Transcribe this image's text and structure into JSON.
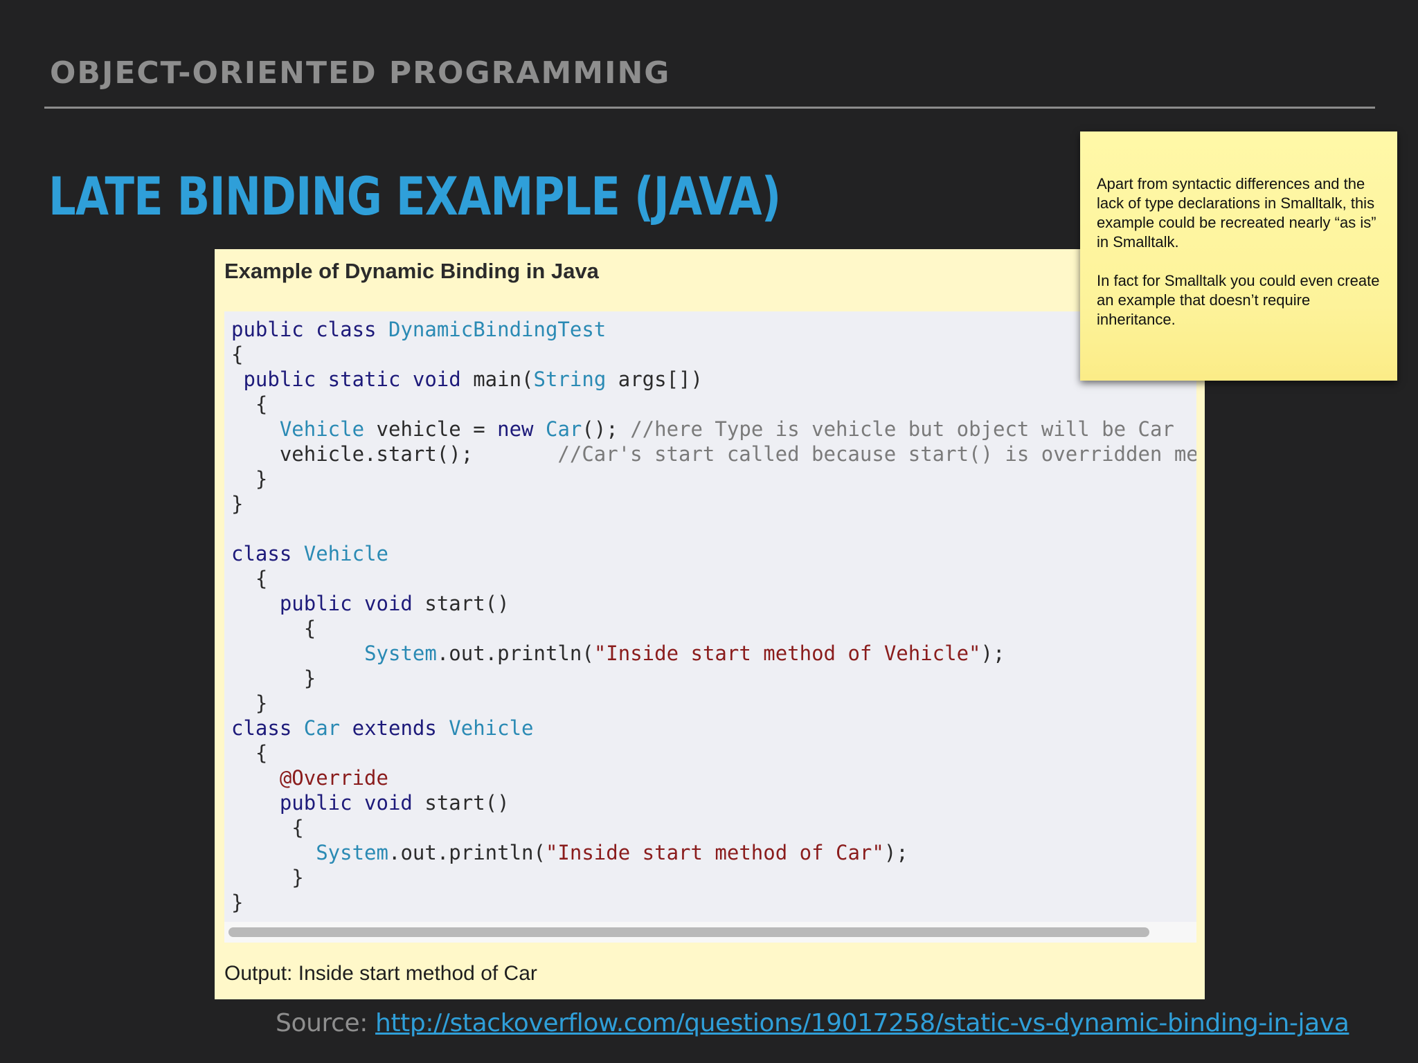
{
  "slide": {
    "section_title": "OBJECT-ORIENTED PROGRAMMING",
    "title": "LATE BINDING EXAMPLE (JAVA)"
  },
  "example": {
    "heading": "Example of Dynamic Binding in Java",
    "output": "Output: Inside start method of Car",
    "code_lines": [
      [
        {
          "t": "public class ",
          "c": "kw"
        },
        {
          "t": "DynamicBindingTest",
          "c": "ty"
        }
      ],
      [
        {
          "t": "{",
          "c": ""
        }
      ],
      [
        {
          "t": " public static void ",
          "c": "kw"
        },
        {
          "t": "main(",
          "c": ""
        },
        {
          "t": "String",
          "c": "ty"
        },
        {
          "t": " args[])",
          "c": ""
        }
      ],
      [
        {
          "t": "  {",
          "c": ""
        }
      ],
      [
        {
          "t": "    ",
          "c": ""
        },
        {
          "t": "Vehicle",
          "c": "ty"
        },
        {
          "t": " vehicle = ",
          "c": ""
        },
        {
          "t": "new",
          "c": "kw"
        },
        {
          "t": " ",
          "c": ""
        },
        {
          "t": "Car",
          "c": "ty"
        },
        {
          "t": "(); ",
          "c": ""
        },
        {
          "t": "//here Type is vehicle but object will be Car",
          "c": "cm"
        }
      ],
      [
        {
          "t": "    vehicle.start();       ",
          "c": ""
        },
        {
          "t": "//Car's start called because start() is overridden met",
          "c": "cm"
        }
      ],
      [
        {
          "t": "  }",
          "c": ""
        }
      ],
      [
        {
          "t": "}",
          "c": ""
        }
      ],
      [
        {
          "t": "",
          "c": ""
        }
      ],
      [
        {
          "t": "class ",
          "c": "kw"
        },
        {
          "t": "Vehicle",
          "c": "ty"
        }
      ],
      [
        {
          "t": "  {",
          "c": ""
        }
      ],
      [
        {
          "t": "    public void ",
          "c": "kw"
        },
        {
          "t": "start()",
          "c": ""
        }
      ],
      [
        {
          "t": "      {",
          "c": ""
        }
      ],
      [
        {
          "t": "           ",
          "c": ""
        },
        {
          "t": "System",
          "c": "ty"
        },
        {
          "t": ".out.println(",
          "c": ""
        },
        {
          "t": "\"Inside start method of Vehicle\"",
          "c": "st"
        },
        {
          "t": ");",
          "c": ""
        }
      ],
      [
        {
          "t": "      }",
          "c": ""
        }
      ],
      [
        {
          "t": "  }",
          "c": ""
        }
      ],
      [
        {
          "t": "class ",
          "c": "kw"
        },
        {
          "t": "Car",
          "c": "ty"
        },
        {
          "t": " extends ",
          "c": "kw"
        },
        {
          "t": "Vehicle",
          "c": "ty"
        }
      ],
      [
        {
          "t": "  {",
          "c": ""
        }
      ],
      [
        {
          "t": "    ",
          "c": ""
        },
        {
          "t": "@Override",
          "c": "an"
        }
      ],
      [
        {
          "t": "    public void ",
          "c": "kw"
        },
        {
          "t": "start()",
          "c": ""
        }
      ],
      [
        {
          "t": "     {",
          "c": ""
        }
      ],
      [
        {
          "t": "       ",
          "c": ""
        },
        {
          "t": "System",
          "c": "ty"
        },
        {
          "t": ".out.println(",
          "c": ""
        },
        {
          "t": "\"Inside start method of Car\"",
          "c": "st"
        },
        {
          "t": ");",
          "c": ""
        }
      ],
      [
        {
          "t": "     }",
          "c": ""
        }
      ],
      [
        {
          "t": "}",
          "c": ""
        }
      ]
    ]
  },
  "sticky_note": {
    "paragraph_1": "Apart from syntactic differences and the lack of type declarations in Smalltalk, this example could be recreated nearly “as is” in Smalltalk.",
    "paragraph_2": "In fact for Smalltalk you could even create an example that doesn’t require inheritance."
  },
  "source": {
    "label": "Source: ",
    "url": "http://stackoverflow.com/questions/19017258/static-vs-dynamic-binding-in-java"
  }
}
